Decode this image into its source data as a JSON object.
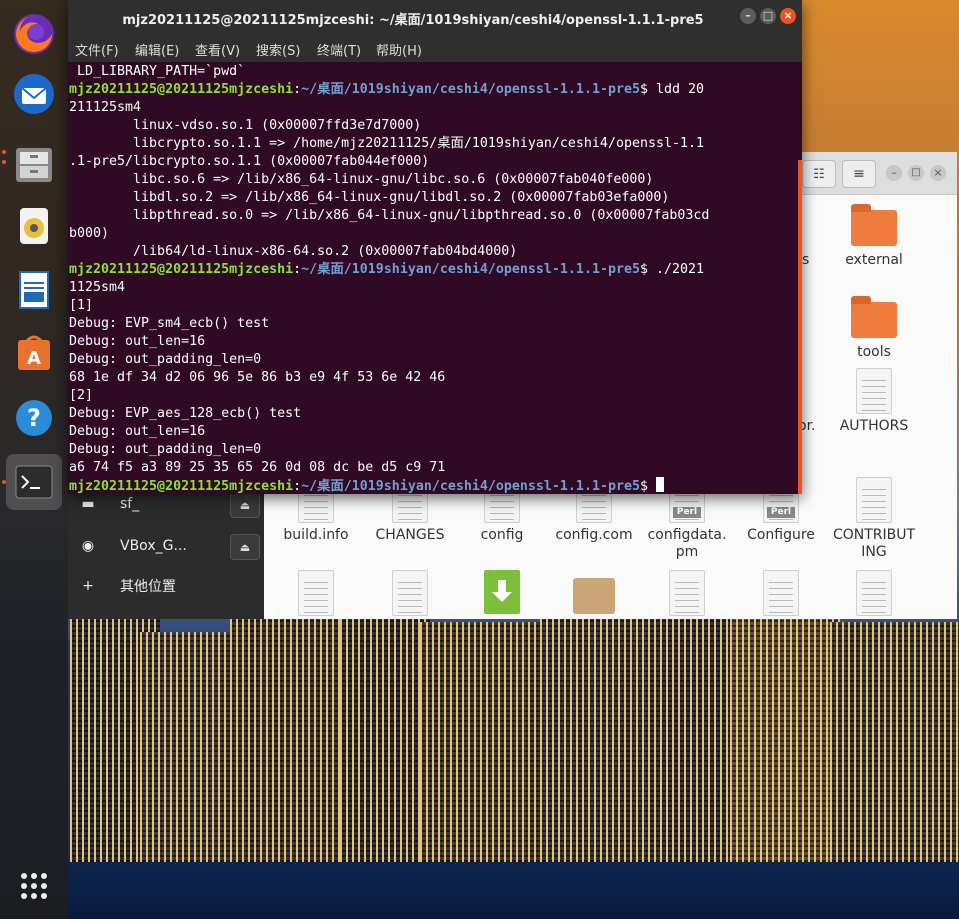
{
  "terminal": {
    "title": "mjz20211125@20211125mjzceshi: ~/桌面/1019shiyan/ceshi4/openssl-1.1.1-pre5",
    "menu": [
      "文件(F)",
      "编辑(E)",
      "查看(V)",
      "搜索(S)",
      "终端(T)",
      "帮助(H)"
    ],
    "prompt_user": "mjz20211125@20211125mjzceshi",
    "prompt_path": "~/桌面/1019shiyan/ceshi4/openssl-1.1.1-pre5",
    "lines": {
      "l0": " LD_LIBRARY_PATH=`pwd`",
      "cmd1a": " ldd 20",
      "l2": "211125sm4",
      "l3": "        linux-vdso.so.1 (0x00007ffd3e7d7000)",
      "l4": "        libcrypto.so.1.1 => /home/mjz20211125/桌面/1019shiyan/ceshi4/openssl-1.1",
      "l5": ".1-pre5/libcrypto.so.1.1 (0x00007fab044ef000)",
      "l6": "        libc.so.6 => /lib/x86_64-linux-gnu/libc.so.6 (0x00007fab040fe000)",
      "l7": "        libdl.so.2 => /lib/x86_64-linux-gnu/libdl.so.2 (0x00007fab03efa000)",
      "l8": "        libpthread.so.0 => /lib/x86_64-linux-gnu/libpthread.so.0 (0x00007fab03cd",
      "l9": "b000)",
      "l10": "        /lib64/ld-linux-x86-64.so.2 (0x00007fab04bd4000)",
      "cmd2a": " ./2021",
      "l12": "1125sm4",
      "l13": "[1]",
      "l14": "Debug: EVP_sm4_ecb() test",
      "l15": "Debug: out_len=16",
      "l16": "Debug: out_padding_len=0",
      "l17": "68 1e df 34 d2 06 96 5e 86 b3 e9 4f 53 6e 42 46",
      "l18": "[2]",
      "l19": "Debug: EVP_aes_128_ecb() test",
      "l20": "Debug: out_len=16",
      "l21": "Debug: out_padding_len=0",
      "l22": "a6 74 f5 a3 89 25 35 65 26 0d 08 dc be d5 c9 71"
    }
  },
  "files": {
    "sidebar": [
      {
        "label": "sf_",
        "icon": "drive-icon"
      },
      {
        "label": "VBox_G...",
        "icon": "disc-icon"
      },
      {
        "label": "其他位置",
        "icon": "plus-icon"
      }
    ],
    "partial_labels": [
      "s",
      "or."
    ],
    "folders": [
      "external",
      "tools"
    ],
    "authors": "AUTHORS",
    "row": [
      "build.info",
      "CHANGES",
      "config",
      "config.com",
      "configdata.\npm",
      "Configure",
      "CONTRIBUT\nING"
    ]
  },
  "dock": [
    "firefox-icon",
    "thunderbird-icon",
    "files-icon",
    "rhythmbox-icon",
    "writer-icon",
    "software-icon",
    "help-icon",
    "terminal-icon",
    "apps-grid-icon"
  ]
}
